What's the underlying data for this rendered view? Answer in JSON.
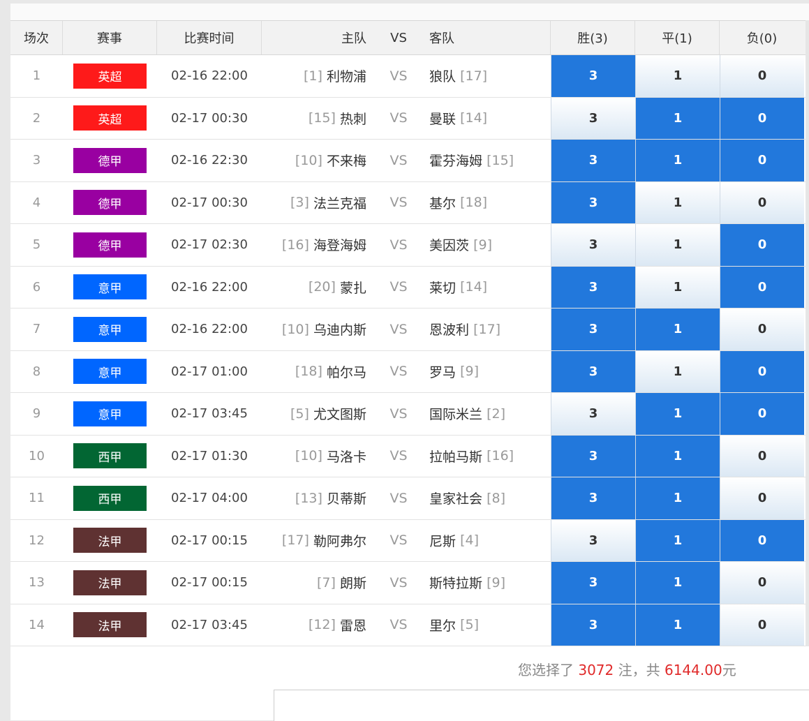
{
  "header": {
    "idx": "场次",
    "league": "赛事",
    "time": "比赛时间",
    "home": "主队",
    "vs": "VS",
    "away": "客队",
    "win": "胜(3)",
    "draw": "平(1)",
    "lose": "负(0)"
  },
  "colors": {
    "英超": "#fe1a1a",
    "德甲": "#9900a1",
    "意甲": "#0066ff",
    "西甲": "#026633",
    "法甲": "#5f3232",
    "selected": "#2278dc"
  },
  "matches": [
    {
      "idx": "1",
      "league": "英超",
      "time": "02-16 22:00",
      "home_rank": "[1]",
      "home": "利物浦",
      "vs": "VS",
      "away": "狼队",
      "away_rank": "[17]",
      "w": "3",
      "d": "1",
      "l": "0",
      "sel": [
        true,
        false,
        false
      ]
    },
    {
      "idx": "2",
      "league": "英超",
      "time": "02-17 00:30",
      "home_rank": "[15]",
      "home": "热刺",
      "vs": "VS",
      "away": "曼联",
      "away_rank": "[14]",
      "w": "3",
      "d": "1",
      "l": "0",
      "sel": [
        false,
        true,
        true
      ]
    },
    {
      "idx": "3",
      "league": "德甲",
      "time": "02-16 22:30",
      "home_rank": "[10]",
      "home": "不来梅",
      "vs": "VS",
      "away": "霍芬海姆",
      "away_rank": "[15]",
      "w": "3",
      "d": "1",
      "l": "0",
      "sel": [
        true,
        true,
        true
      ]
    },
    {
      "idx": "4",
      "league": "德甲",
      "time": "02-17 00:30",
      "home_rank": "[3]",
      "home": "法兰克福",
      "vs": "VS",
      "away": "基尔",
      "away_rank": "[18]",
      "w": "3",
      "d": "1",
      "l": "0",
      "sel": [
        true,
        false,
        false
      ]
    },
    {
      "idx": "5",
      "league": "德甲",
      "time": "02-17 02:30",
      "home_rank": "[16]",
      "home": "海登海姆",
      "vs": "VS",
      "away": "美因茨",
      "away_rank": "[9]",
      "w": "3",
      "d": "1",
      "l": "0",
      "sel": [
        false,
        false,
        true
      ]
    },
    {
      "idx": "6",
      "league": "意甲",
      "time": "02-16 22:00",
      "home_rank": "[20]",
      "home": "蒙扎",
      "vs": "VS",
      "away": "莱切",
      "away_rank": "[14]",
      "w": "3",
      "d": "1",
      "l": "0",
      "sel": [
        true,
        false,
        true
      ]
    },
    {
      "idx": "7",
      "league": "意甲",
      "time": "02-16 22:00",
      "home_rank": "[10]",
      "home": "乌迪内斯",
      "vs": "VS",
      "away": "恩波利",
      "away_rank": "[17]",
      "w": "3",
      "d": "1",
      "l": "0",
      "sel": [
        true,
        true,
        false
      ]
    },
    {
      "idx": "8",
      "league": "意甲",
      "time": "02-17 01:00",
      "home_rank": "[18]",
      "home": "帕尔马",
      "vs": "VS",
      "away": "罗马",
      "away_rank": "[9]",
      "w": "3",
      "d": "1",
      "l": "0",
      "sel": [
        true,
        false,
        true
      ]
    },
    {
      "idx": "9",
      "league": "意甲",
      "time": "02-17 03:45",
      "home_rank": "[5]",
      "home": "尤文图斯",
      "vs": "VS",
      "away": "国际米兰",
      "away_rank": "[2]",
      "w": "3",
      "d": "1",
      "l": "0",
      "sel": [
        false,
        true,
        true
      ]
    },
    {
      "idx": "10",
      "league": "西甲",
      "time": "02-17 01:30",
      "home_rank": "[10]",
      "home": "马洛卡",
      "vs": "VS",
      "away": "拉帕马斯",
      "away_rank": "[16]",
      "w": "3",
      "d": "1",
      "l": "0",
      "sel": [
        true,
        true,
        false
      ]
    },
    {
      "idx": "11",
      "league": "西甲",
      "time": "02-17 04:00",
      "home_rank": "[13]",
      "home": "贝蒂斯",
      "vs": "VS",
      "away": "皇家社会",
      "away_rank": "[8]",
      "w": "3",
      "d": "1",
      "l": "0",
      "sel": [
        true,
        true,
        false
      ]
    },
    {
      "idx": "12",
      "league": "法甲",
      "time": "02-17 00:15",
      "home_rank": "[17]",
      "home": "勒阿弗尔",
      "vs": "VS",
      "away": "尼斯",
      "away_rank": "[4]",
      "w": "3",
      "d": "1",
      "l": "0",
      "sel": [
        false,
        true,
        true
      ]
    },
    {
      "idx": "13",
      "league": "法甲",
      "time": "02-17 00:15",
      "home_rank": "[7]",
      "home": "朗斯",
      "vs": "VS",
      "away": "斯特拉斯",
      "away_rank": "[9]",
      "w": "3",
      "d": "1",
      "l": "0",
      "sel": [
        true,
        true,
        false
      ]
    },
    {
      "idx": "14",
      "league": "法甲",
      "time": "02-17 03:45",
      "home_rank": "[12]",
      "home": "雷恩",
      "vs": "VS",
      "away": "里尔",
      "away_rank": "[5]",
      "w": "3",
      "d": "1",
      "l": "0",
      "sel": [
        true,
        true,
        false
      ]
    }
  ],
  "summary": {
    "prefix": "您选择了 ",
    "count": "3072",
    "mid": " 注，共 ",
    "amount": "6144.00",
    "suffix": "元"
  }
}
